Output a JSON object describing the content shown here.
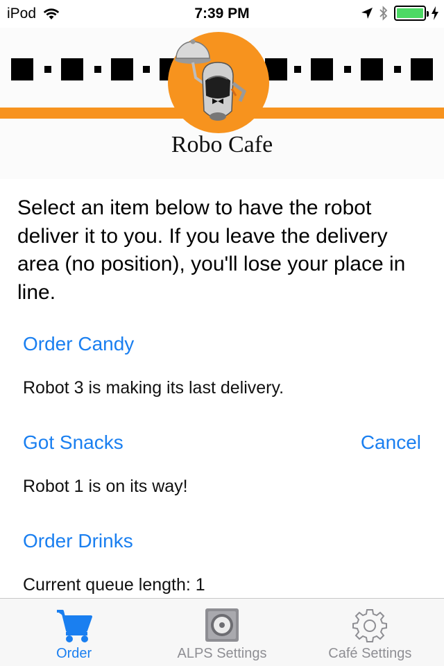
{
  "status_bar": {
    "carrier": "iPod",
    "time": "7:39 PM",
    "battery_color": "#4cd964"
  },
  "header": {
    "brand_title": "Robo Cafe",
    "accent_color": "#f7931e"
  },
  "main": {
    "intro_text": "Select an item below to have the robot deliver it to you. If you leave the delivery area (no position), you'll lose your place in line.",
    "items": [
      {
        "action_label": "Order Candy",
        "status": "Robot 3 is making its last delivery."
      },
      {
        "action_label": "Got Snacks",
        "cancel_label": "Cancel",
        "status": "Robot 1 is on its way!"
      },
      {
        "action_label": "Order Drinks",
        "status": "Current queue length: 1"
      }
    ],
    "link_color": "#1a7ff0"
  },
  "tab_bar": {
    "tabs": [
      {
        "label": "Order",
        "icon": "cart-icon",
        "active": true
      },
      {
        "label": "ALPS Settings",
        "icon": "speaker-icon",
        "active": false
      },
      {
        "label": "Café Settings",
        "icon": "gear-icon",
        "active": false
      }
    ]
  }
}
